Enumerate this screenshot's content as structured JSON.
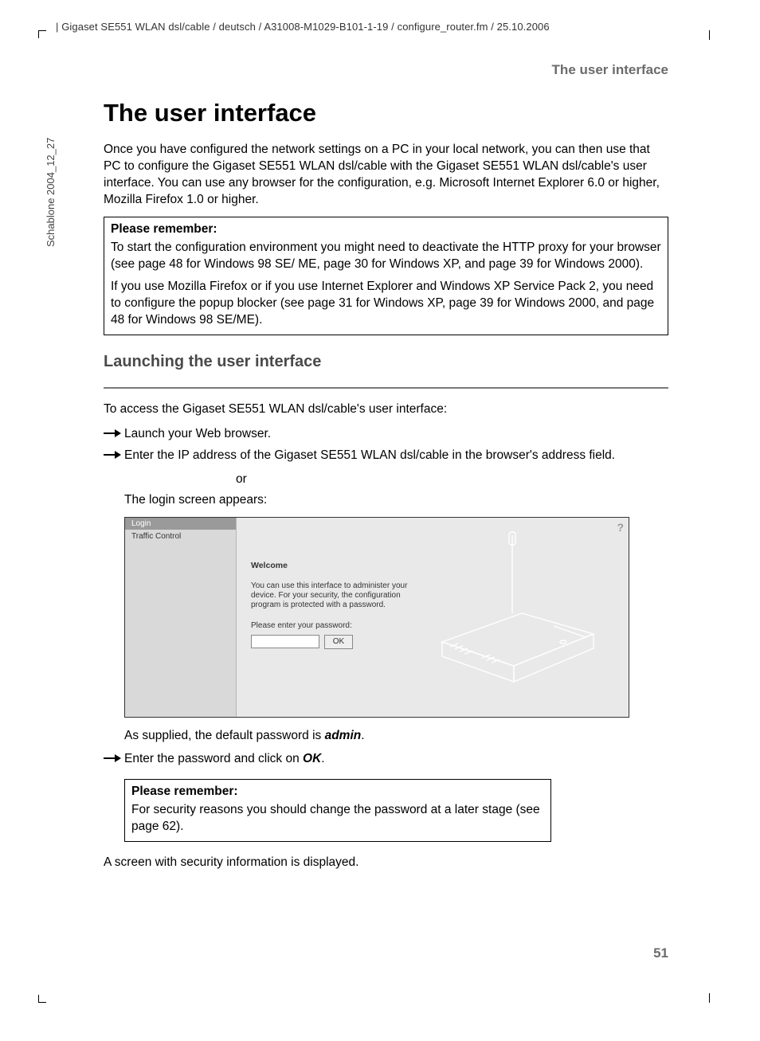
{
  "header_line": "Gigaset SE551 WLAN dsl/cable / deutsch / A31008-M1029-B101-1-19 / configure_router.fm / 25.10.2006",
  "side_label": "Schablone 2004_12_27",
  "running_head": "The user interface",
  "h1": "The user interface",
  "intro": "Once you have configured the network settings on a PC in your local network, you can then use that PC to configure the Gigaset SE551 WLAN dsl/cable with the Gigaset SE551 WLAN dsl/cable's user interface. You can use any browser for the configuration, e.g. Microsoft Internet Explorer 6.0 or higher, Mozilla Firefox 1.0 or higher.",
  "box1": {
    "title": "Please remember:",
    "p1": "To start the configuration environment you might need to deactivate the HTTP proxy for your browser (see page 48 for Windows 98 SE/ ME, page 30 for Windows XP, and page 39 for Windows 2000).",
    "p2": "If you use Mozilla Firefox or if you use Internet Explorer and Windows XP Service Pack 2, you need to configure the popup blocker (see page 31 for Windows XP, page 39 for Windows 2000, and page 48 for Windows 98 SE/ME)."
  },
  "h2": "Launching the user interface",
  "access_line": "To access the Gigaset SE551 WLAN dsl/cable's user interface:",
  "step1": "Launch your Web browser.",
  "step2": "Enter the IP address of the Gigaset SE551 WLAN dsl/cable in the browser's address field.",
  "or_label": "or",
  "login_appears": "The login screen appears:",
  "screenshot": {
    "nav_login": "Login",
    "nav_traffic": "Traffic Control",
    "help_icon": "?",
    "welcome": "Welcome",
    "desc": "You can use this interface to administer your device. For your security, the configuration program is protected with a password.",
    "prompt": "Please enter your password:",
    "ok_label": "OK"
  },
  "default_pw_pre": "As supplied, the default password is ",
  "default_pw_bold": "admin",
  "default_pw_post": ".",
  "step3_pre": "Enter the password and click on ",
  "step3_bold": "OK",
  "step3_post": ".",
  "box2": {
    "title": "Please remember:",
    "p1": "For security reasons you should change the password at a later stage (see page 62)."
  },
  "closing": "A screen with security information is displayed.",
  "page_number": "51"
}
